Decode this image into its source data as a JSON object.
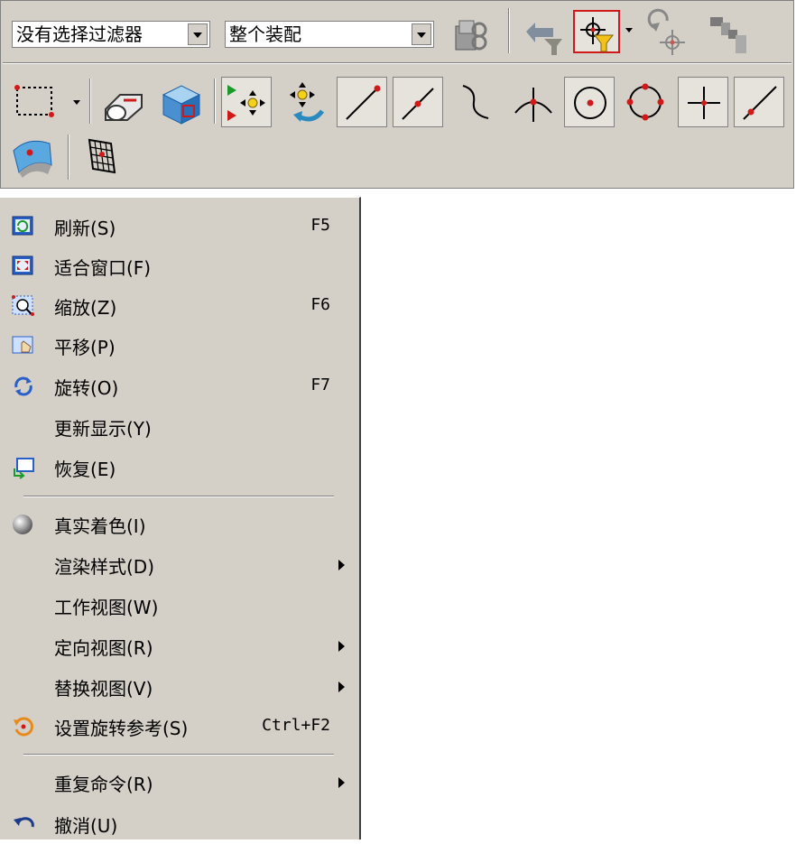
{
  "toolbar": {
    "filter_combo": {
      "value": "没有选择过滤器"
    },
    "assembly_combo": {
      "value": "整个装配"
    },
    "row1_icons": [
      "assembly-select-icon",
      "undo-filter-icon",
      "point-filter-icon",
      "rotate-point-icon",
      "chain-icon"
    ],
    "row2_icons": [
      "rectangle-select-icon",
      "section-icon",
      "cube-select-icon",
      "snap-points-icon",
      "snap-point-rotate-icon",
      "line-endpoint-icon",
      "line-midpoint-icon",
      "curve-icon",
      "intersection-icon",
      "arc-center-icon",
      "quadrant-point-icon",
      "existing-point-icon",
      "point-on-curve-icon"
    ],
    "row3_icons": [
      "surface-point-icon",
      "grid-point-icon"
    ]
  },
  "menu": {
    "items": [
      {
        "icon": "refresh-icon",
        "label": "刷新(S)",
        "shortcut": "F5",
        "submenu": false
      },
      {
        "icon": "fit-window-icon",
        "label": "适合窗口(F)",
        "shortcut": "",
        "submenu": false
      },
      {
        "icon": "zoom-icon",
        "label": "缩放(Z)",
        "shortcut": "F6",
        "submenu": false
      },
      {
        "icon": "pan-icon",
        "label": "平移(P)",
        "shortcut": "",
        "submenu": false
      },
      {
        "icon": "rotate-icon",
        "label": "旋转(O)",
        "shortcut": "F7",
        "submenu": false
      },
      {
        "icon": "",
        "label": "更新显示(Y)",
        "shortcut": "",
        "submenu": false
      },
      {
        "icon": "restore-icon",
        "label": "恢复(E)",
        "shortcut": "",
        "submenu": false
      },
      {
        "icon": "shading-sphere-icon",
        "label": "真实着色(I)",
        "shortcut": "",
        "submenu": false
      },
      {
        "icon": "",
        "label": "渲染样式(D)",
        "shortcut": "",
        "submenu": true
      },
      {
        "icon": "",
        "label": "工作视图(W)",
        "shortcut": "",
        "submenu": false
      },
      {
        "icon": "",
        "label": "定向视图(R)",
        "shortcut": "",
        "submenu": true
      },
      {
        "icon": "",
        "label": "替换视图(V)",
        "shortcut": "",
        "submenu": true
      },
      {
        "icon": "rotation-reference-icon",
        "label": "设置旋转参考(S)",
        "shortcut": "Ctrl+F2",
        "submenu": false
      },
      {
        "icon": "",
        "label": "重复命令(R)",
        "shortcut": "",
        "submenu": true
      },
      {
        "icon": "undo-icon",
        "label": "撤消(U)",
        "shortcut": "",
        "submenu": false
      }
    ]
  }
}
